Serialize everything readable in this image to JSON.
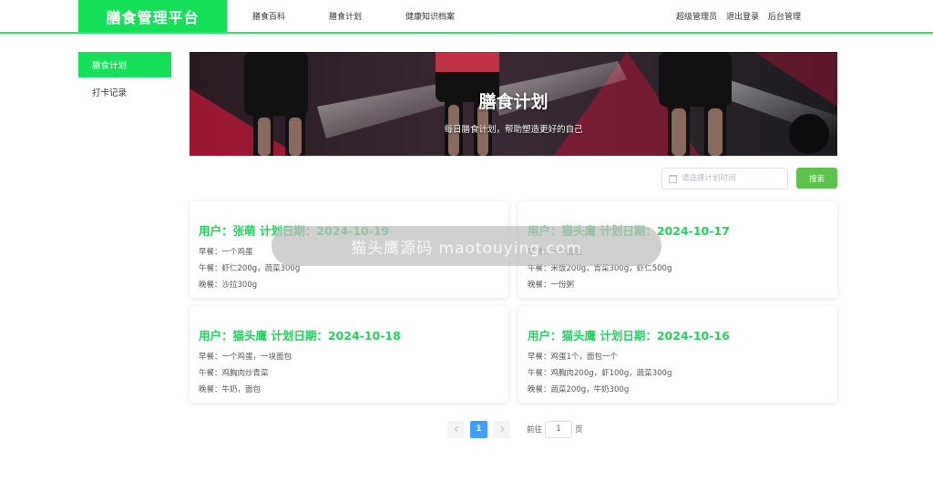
{
  "header": {
    "brand": "膳食管理平台",
    "nav": [
      "膳食百科",
      "膳食计划",
      "健康知识档案"
    ],
    "user": "超级管理员",
    "logout": "退出登录",
    "admin": "后台管理"
  },
  "sidebar": {
    "items": [
      {
        "label": "膳食计划",
        "active": true
      },
      {
        "label": "打卡记录",
        "active": false
      }
    ]
  },
  "banner": {
    "title": "膳食计划",
    "subtitle": "每日膳食计划，帮助塑造更好的自己"
  },
  "search": {
    "placeholder": "请选择计划时间",
    "button": "搜索"
  },
  "cards": [
    {
      "title": "用户：张萌   计划日期：2024-10-19",
      "breakfast": "早餐：一个鸡蛋",
      "lunch": "午餐：虾仁200g，蔬菜300g",
      "dinner": "晚餐：沙拉300g"
    },
    {
      "title": "用户：猫头鹰   计划日期：2024-10-17",
      "breakfast": "早餐：一个面包",
      "lunch": "午餐：米饭200g，青菜300g，虾仁500g",
      "dinner": "晚餐：一份粥"
    },
    {
      "title": "用户：猫头鹰   计划日期：2024-10-18",
      "breakfast": "早餐：一个鸡蛋，一块面包",
      "lunch": "午餐：鸡胸肉炒青菜",
      "dinner": "晚餐：牛奶，面包"
    },
    {
      "title": "用户：猫头鹰   计划日期：2024-10-16",
      "breakfast": "早餐：鸡蛋1个，面包一个",
      "lunch": "午餐：鸡胸肉200g，虾100g，蔬菜300g",
      "dinner": "晚餐：蔬菜200g，牛奶300g"
    }
  ],
  "watermark": "猫头鹰源码 maotouying.com",
  "pagination": {
    "prev_icon": "chevron-left-icon",
    "next_icon": "chevron-right-icon",
    "current": "1",
    "goto_prefix": "前往",
    "goto_value": "1",
    "goto_suffix": "页"
  },
  "colors": {
    "brand_green": "#15e05a",
    "title_green": "#1fd35c",
    "search_green": "#5cc24b",
    "page_blue": "#409eff"
  }
}
